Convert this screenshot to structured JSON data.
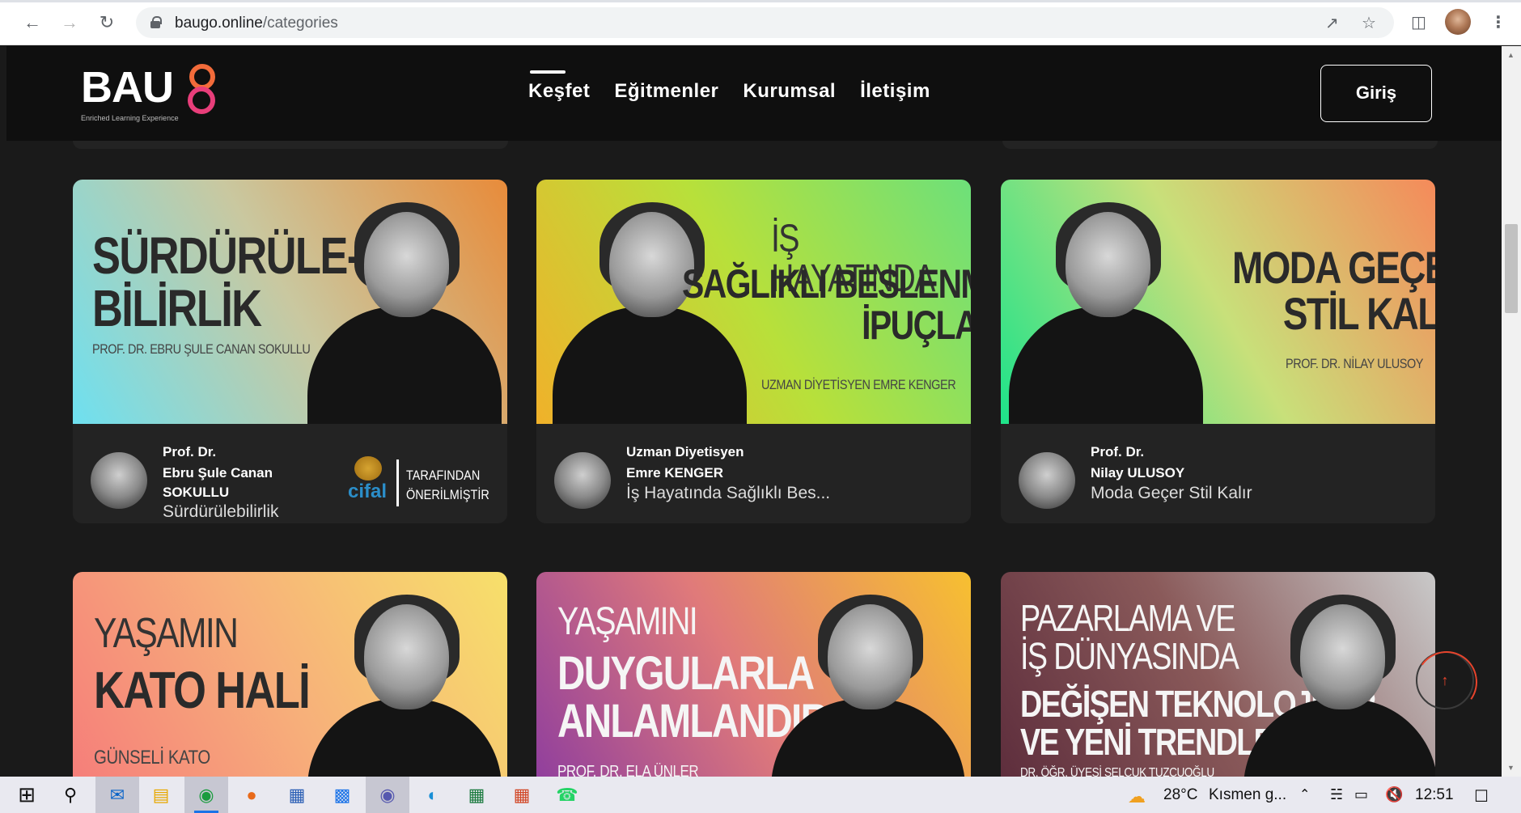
{
  "browser": {
    "url_host": "baugo.online",
    "url_path": "/categories"
  },
  "site": {
    "logo_text": "BAU",
    "logo_tagline": "Enriched Learning Experience",
    "nav": [
      "Keşfet",
      "Eğitmenler",
      "Kurumsal",
      "İletişim"
    ],
    "active_nav": "Keşfet",
    "login_label": "Giriş"
  },
  "cards": [
    {
      "banner_title": "SÜRDÜRÜLE-\nBİLİRLİK",
      "banner_subtitle": "PROF. DR. EBRU ŞULE CANAN SOKULLU",
      "gradient": [
        "#6ee0f0",
        "#c9c8a0",
        "#e88b3a"
      ],
      "role": "Prof. Dr.",
      "name": "Ebru Şule Canan\nSOKULLU",
      "course": "Sürdürülebilirlik",
      "partner_name": "cifal",
      "partner_text": "TARAFINDAN\nÖNERİLMİŞTİR"
    },
    {
      "banner_title_light": "İŞ HAYATINDA",
      "banner_title": "SAĞLIKLI BESLENME\nİPUÇLARI",
      "banner_subtitle": "UZMAN DİYETİSYEN EMRE KENGER",
      "gradient": [
        "#f0b12a",
        "#b8e03a",
        "#6de07a"
      ],
      "role": "Uzman Diyetisyen",
      "name": "Emre KENGER",
      "course": "İş Hayatında Sağlıklı Bes..."
    },
    {
      "banner_title": "MODA GEÇER\nSTİL KALIR",
      "banner_subtitle": "PROF. DR. NİLAY ULUSOY",
      "gradient": [
        "#1de38a",
        "#c8e07a",
        "#f58a5a"
      ],
      "role": "Prof. Dr.",
      "name": "Nilay ULUSOY",
      "course": "Moda Geçer Stil Kalır"
    },
    {
      "banner_title_light": "YAŞAMIN",
      "banner_title": "KATO HALİ",
      "banner_subtitle": "GÜNSELİ KATO",
      "gradient": [
        "#f57a7a",
        "#f7b07a",
        "#f7e06a"
      ]
    },
    {
      "banner_title_light": "YAŞAMINI",
      "banner_title": "DUYGULARLA\nANLAMLANDIR",
      "banner_subtitle": "PROF. DR. ELA ÜNLER",
      "gradient": [
        "#8a3aa0",
        "#e07a7a",
        "#f7c030"
      ]
    },
    {
      "banner_title_light": "PAZARLAMA VE\nİŞ DÜNYASINDA",
      "banner_title": "DEĞİŞEN TEKNOLOJİLER\nVE YENİ TRENDLER",
      "banner_subtitle": "DR. ÖĞR. ÜYESİ SELÇUK TUZCUOĞLU",
      "gradient": [
        "#5a2a3a",
        "#8a5a5a",
        "#c9c9c9"
      ]
    }
  ],
  "taskbar": {
    "weather_temp": "28°C",
    "weather_text": "Kısmen g...",
    "clock": "12:51"
  },
  "colors": {
    "page_bg": "#1a1a1a",
    "header_bg": "#0f0f0f",
    "card_info_bg": "#232323",
    "accent": "#e8442c"
  }
}
